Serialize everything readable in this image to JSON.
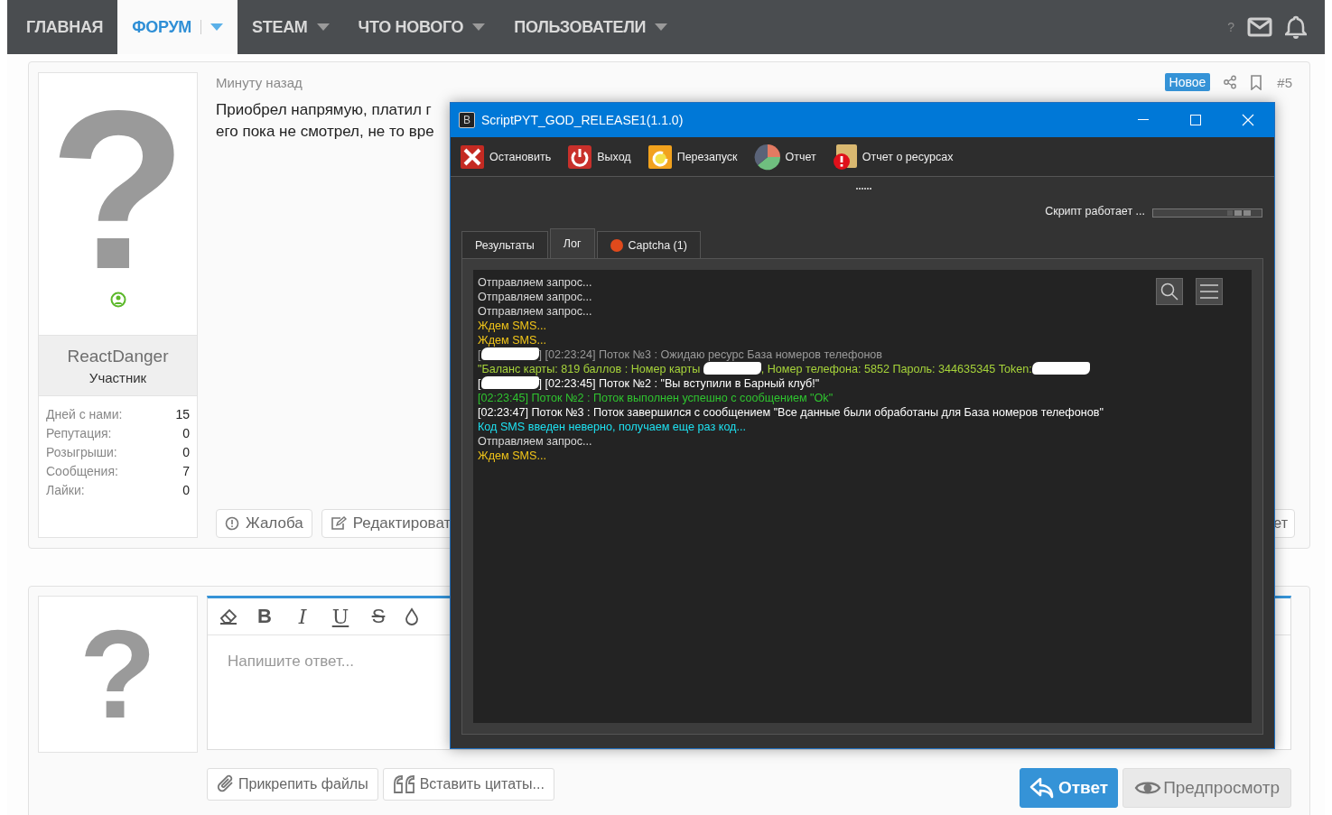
{
  "nav": {
    "items": [
      {
        "label": "ГЛАВНАЯ",
        "selected": false,
        "has_menu": false
      },
      {
        "label": "ФОРУМ",
        "selected": true,
        "has_menu": true
      },
      {
        "label": "STEAM",
        "selected": false,
        "has_menu": true
      },
      {
        "label": "ЧТО НОВОГО",
        "selected": false,
        "has_menu": true
      },
      {
        "label": "ПОЛЬЗОВАТЕЛИ",
        "selected": false,
        "has_menu": true
      }
    ],
    "help": "?"
  },
  "post": {
    "author": {
      "avatar": "?",
      "online": true,
      "name": "ReactDanger",
      "role": "Участник",
      "stats": [
        {
          "label": "Дней с нами:",
          "value": "15"
        },
        {
          "label": "Репутация:",
          "value": "0"
        },
        {
          "label": "Розыгрыши:",
          "value": "0"
        },
        {
          "label": "Сообщения:",
          "value": "7"
        },
        {
          "label": "Лайки:",
          "value": "0"
        }
      ]
    },
    "time": "Минуту назад",
    "lines": [
      "Приобрел напрямую, платил г",
      "его пока не смотрел, не то вре"
    ],
    "badge": "Новое",
    "number": "#5",
    "actions": [
      {
        "kind": "report",
        "label": "Жалоба"
      },
      {
        "kind": "edit",
        "label": "Редактироват"
      }
    ],
    "right_action": "ет"
  },
  "reply": {
    "avatar": "?",
    "toolbar": [
      {
        "kind": "eraser"
      },
      {
        "kind": "bold",
        "label": "B"
      },
      {
        "kind": "italic",
        "label": "I"
      },
      {
        "kind": "underline",
        "label": "U"
      },
      {
        "kind": "strike",
        "label": "S"
      },
      {
        "kind": "color"
      }
    ],
    "placeholder": "Напишите ответ...",
    "buttons": [
      {
        "kind": "attach",
        "label": "Прикрепить файлы"
      },
      {
        "kind": "quote",
        "label": "Вставить цитаты..."
      },
      {
        "kind": "reply",
        "label": "Ответ"
      },
      {
        "kind": "preview",
        "label": "Предпросмотр"
      }
    ]
  },
  "window": {
    "icon_letter": "B",
    "title": "ScriptPYT_GOD_RELEASE1(1.1.0)",
    "toolbar": [
      {
        "kind": "stop",
        "label": "Остановить"
      },
      {
        "kind": "exit",
        "label": "Выход"
      },
      {
        "kind": "restart",
        "label": "Перезапуск"
      },
      {
        "kind": "report",
        "label": "Отчет"
      },
      {
        "kind": "resources",
        "label": "Отчет о ресурсах"
      }
    ],
    "status": "Скрипт работает ...",
    "tabs": [
      {
        "label": "Результаты",
        "selected": false
      },
      {
        "label": "Лог",
        "selected": true
      },
      {
        "label": "Captcha (1)",
        "selected": false,
        "color": "#e04a1c"
      }
    ],
    "log": [
      {
        "color": "#d8d8d8",
        "segments": [
          {
            "text": "Отправляем запрос..."
          }
        ]
      },
      {
        "color": "#d8d8d8",
        "segments": [
          {
            "text": "Отправляем запрос..."
          }
        ]
      },
      {
        "color": "#d8d8d8",
        "segments": [
          {
            "text": "Отправляем запрос..."
          }
        ]
      },
      {
        "color": "#f0c419",
        "segments": [
          {
            "text": "Ждем SMS..."
          }
        ]
      },
      {
        "color": "#f0c419",
        "segments": [
          {
            "text": "Ждем SMS..."
          }
        ]
      },
      {
        "color": "#9a9a9a",
        "segments": [
          {
            "text": "["
          },
          {
            "kind": "redaction"
          },
          {
            "text": "] [02:23:24] Поток №3 : Ожидаю ресурс База номеров телефонов"
          }
        ]
      },
      {
        "color": "#a6d33a",
        "segments": [
          {
            "text": "\"Баланс карты: 819 баллов : Номер карты "
          },
          {
            "kind": "redaction"
          },
          {
            "text": ", Номер телефона: 5852 Пароль: 344635345 Token:"
          },
          {
            "kind": "redaction"
          }
        ]
      },
      {
        "color": "#ffffff",
        "segments": [
          {
            "text": "["
          },
          {
            "kind": "redaction"
          },
          {
            "text": "] [02:23:45] Поток №2 : \"Вы вступили в Барный клуб!\""
          }
        ]
      },
      {
        "color": "#2fc42f",
        "segments": [
          {
            "text": "[02:23:45] Поток №2 : Поток выполнен успешно с сообщением \"Ok\""
          }
        ]
      },
      {
        "color": "#ffffff",
        "segments": [
          {
            "text": "[02:23:47] Поток №3 : Поток завершился с сообщением \"Все данные были обработаны для База номеров телефонов\""
          }
        ]
      },
      {
        "color": "#1ee0f0",
        "segments": [
          {
            "text": "Код SMS введен неверно, получаем еще раз код..."
          }
        ]
      },
      {
        "color": "#d8d8d8",
        "segments": [
          {
            "text": "Отправляем запрос..."
          }
        ]
      },
      {
        "color": "#f0c419",
        "segments": [
          {
            "text": "Ждем SMS..."
          }
        ]
      }
    ]
  }
}
